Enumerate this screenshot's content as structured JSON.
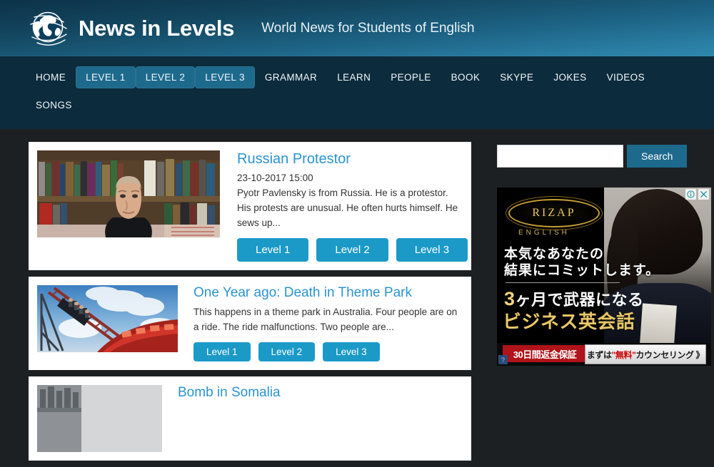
{
  "header": {
    "brand": "News in Levels",
    "tagline": "World News for Students of English",
    "logo_icon": "globe-icon"
  },
  "nav": {
    "items": [
      {
        "label": "HOME",
        "active": false
      },
      {
        "label": "LEVEL 1",
        "active": true
      },
      {
        "label": "LEVEL 2",
        "active": true
      },
      {
        "label": "LEVEL 3",
        "active": true
      },
      {
        "label": "GRAMMAR",
        "active": false
      },
      {
        "label": "LEARN",
        "active": false
      },
      {
        "label": "PEOPLE",
        "active": false
      },
      {
        "label": "BOOK",
        "active": false
      },
      {
        "label": "SKYPE",
        "active": false
      },
      {
        "label": "JOKES",
        "active": false
      },
      {
        "label": "VIDEOS",
        "active": false
      },
      {
        "label": "SONGS",
        "active": false
      }
    ]
  },
  "articles": [
    {
      "title": "Russian Protestor",
      "date": "23-10-2017 15:00",
      "excerpt": "Pyotr Pavlensky is from Russia. He is a protestor. His protests are unusual. He often hurts himself. He sews up...",
      "levels": [
        "Level 1",
        "Level 2",
        "Level 3"
      ],
      "thumb_alt": "portrait-of-man-in-front-of-bookshelf"
    },
    {
      "title": "One Year ago: Death in Theme Park",
      "date": "",
      "excerpt": "This happens in a theme park in Australia. Four people are on a ride. The ride malfunctions. Two people are...",
      "levels": [
        "Level 1",
        "Level 2",
        "Level 3"
      ],
      "thumb_alt": "roller-coaster-ride"
    },
    {
      "title": "Bomb in Somalia",
      "date": "",
      "excerpt": "",
      "levels": [],
      "thumb_alt": "damaged-building"
    }
  ],
  "search": {
    "value": "",
    "placeholder": "",
    "button_label": "Search"
  },
  "ad": {
    "brand": "RIZAP",
    "brand_sub": "ENGLISH",
    "headline_line1": "本気なあなたの",
    "headline_line2": "結果にコミットします。",
    "sub_number": "3",
    "sub_line1_rest": "ヶ月で武器になる",
    "sub_line2": "ビジネス英会話",
    "guarantee": "30日間返金保証",
    "cta_pre": "まずは",
    "cta_free": "\"無料\"",
    "cta_post": "カウンセリング 》",
    "info_icon": "info-icon",
    "close_icon": "close-icon",
    "help_icon": "question-mark-icon"
  },
  "colors": {
    "accent_blue": "#1b9ac8",
    "nav_bg": "#0c2b3c",
    "nav_active": "#1e6a8d",
    "page_bg": "#1d2023",
    "link_blue": "#2a93d1",
    "search_button": "#1e6a8d",
    "ad_red": "#b01319",
    "ad_gold": "#e8c766"
  }
}
